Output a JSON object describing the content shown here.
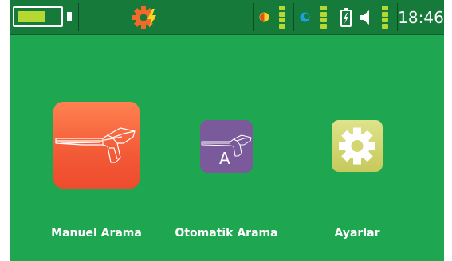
{
  "status_bar": {
    "battery_level": 0.62,
    "settings_icon": "gear-lightning-icon",
    "contrast_icon": "half-circle-icon",
    "brightness_icon": "moon-icon",
    "lock_icon": "battery-lock-icon",
    "volume_icon": "speaker-icon",
    "time": "18:46"
  },
  "apps": [
    {
      "label": "Manuel Arama",
      "icon": "detector-icon"
    },
    {
      "label": "Otomatik Arama",
      "icon": "detector-auto-icon",
      "badge": "A"
    },
    {
      "label": "Ayarlar",
      "icon": "gear-icon"
    }
  ],
  "colors": {
    "background": "#1fa650",
    "status_bar": "#157a3a",
    "accent": "#b6d832",
    "manuel_tile": "#f35a36",
    "otomatik_tile": "#7a5a9a",
    "ayarlar_tile": "#d3d672"
  }
}
